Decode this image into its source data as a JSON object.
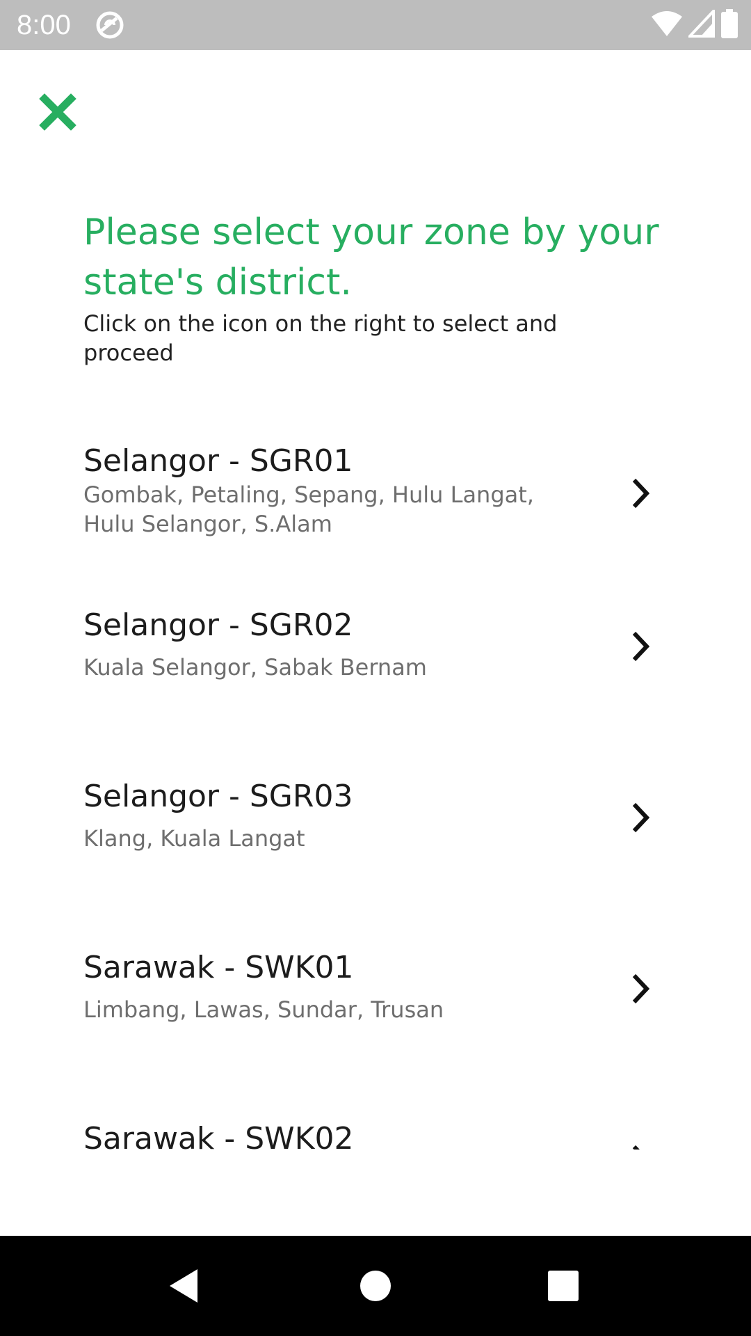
{
  "status_bar": {
    "time": "8:00"
  },
  "header": {
    "close_icon": "close-icon",
    "title": "Please select your zone by your state's district.",
    "subtitle": "Click on the icon on the right to select and proceed"
  },
  "zones": [
    {
      "title": "Selangor - SGR01",
      "districts": "Gombak, Petaling, Sepang, Hulu Langat, Hulu Selangor, S.Alam"
    },
    {
      "title": "Selangor - SGR02",
      "districts": "Kuala Selangor, Sabak Bernam"
    },
    {
      "title": "Selangor - SGR03",
      "districts": "Klang, Kuala Langat"
    },
    {
      "title": "Sarawak - SWK01",
      "districts": "Limbang, Lawas, Sundar, Trusan"
    },
    {
      "title": "Sarawak - SWK02",
      "districts": ""
    }
  ],
  "colors": {
    "accent": "#27ae60",
    "status_bar": "#bdbdbd",
    "nav_bar": "#000000"
  }
}
